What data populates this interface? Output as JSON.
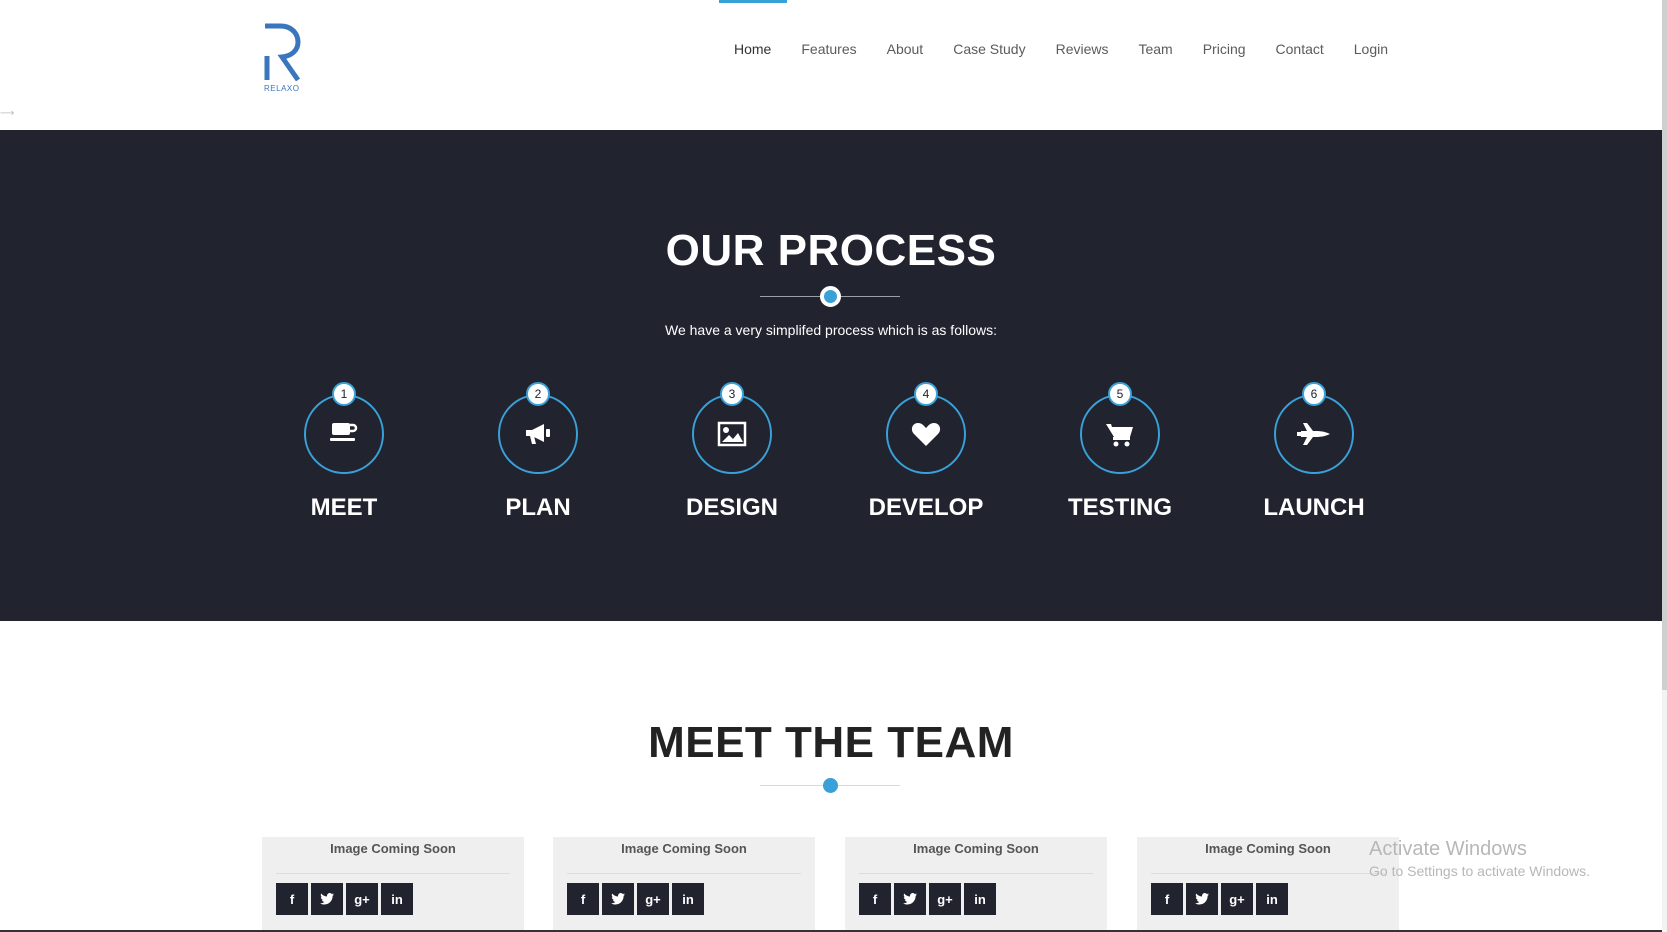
{
  "header": {
    "logo_text": "RELAXO",
    "nav": [
      "Home",
      "Features",
      "About",
      "Case Study",
      "Reviews",
      "Team",
      "Pricing",
      "Contact",
      "Login"
    ],
    "active": "Home"
  },
  "process": {
    "title": "OUR PROCESS",
    "subtitle": "We have a very simplifed process which is as follows:",
    "steps": [
      {
        "num": "1",
        "label": "MEET",
        "icon": "coffee-cup-icon"
      },
      {
        "num": "2",
        "label": "PLAN",
        "icon": "bullhorn-icon"
      },
      {
        "num": "3",
        "label": "DESIGN",
        "icon": "image-icon"
      },
      {
        "num": "4",
        "label": "DEVELOP",
        "icon": "heart-icon"
      },
      {
        "num": "5",
        "label": "TESTING",
        "icon": "shopping-cart-icon"
      },
      {
        "num": "6",
        "label": "LAUNCH",
        "icon": "space-shuttle-icon"
      }
    ]
  },
  "team": {
    "title": "MEET THE TEAM",
    "cards": [
      {
        "image_label": "Image Coming Soon"
      },
      {
        "image_label": "Image Coming Soon"
      },
      {
        "image_label": "Image Coming Soon"
      },
      {
        "image_label": "Image Coming Soon"
      }
    ],
    "social_glyphs": {
      "facebook": "f",
      "twitter": "🐦",
      "google_plus": "g+",
      "linkedin": "in"
    }
  },
  "watermark": {
    "line1": "Activate Windows",
    "line2": "Go to Settings to activate Windows."
  },
  "colors": {
    "accent": "#3aa0d8",
    "dark": "#21232f"
  }
}
